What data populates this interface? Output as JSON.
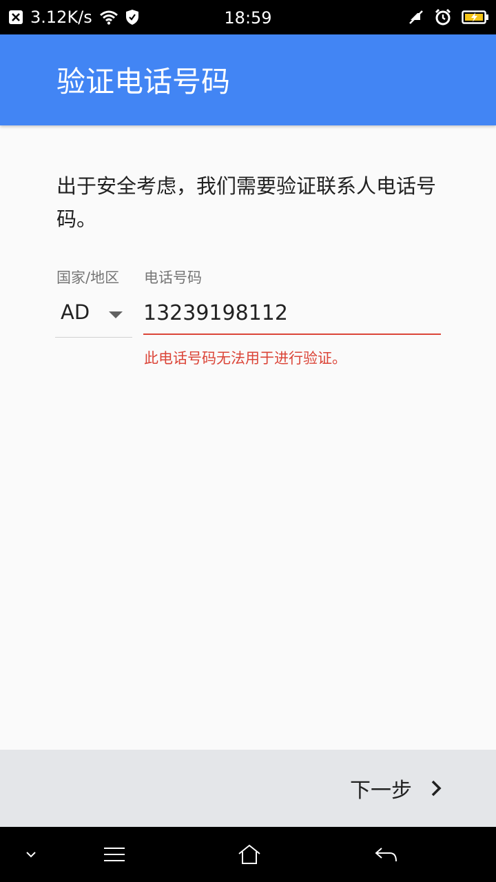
{
  "status_bar": {
    "net_speed": "3.12K/s",
    "time": "18:59"
  },
  "app_bar": {
    "title": "验证电话号码"
  },
  "content": {
    "description": "出于安全考虑，我们需要验证联系人电话号码。",
    "country_label": "国家/地区",
    "phone_label": "电话号码",
    "country_code": "AD",
    "phone_value": "13239198112",
    "error": "此电话号码无法用于进行验证。"
  },
  "bottom_bar": {
    "next_label": "下一步"
  },
  "colors": {
    "app_bar": "#4285f4",
    "error": "#db4437",
    "bottom_bar": "#e4e6e9"
  }
}
